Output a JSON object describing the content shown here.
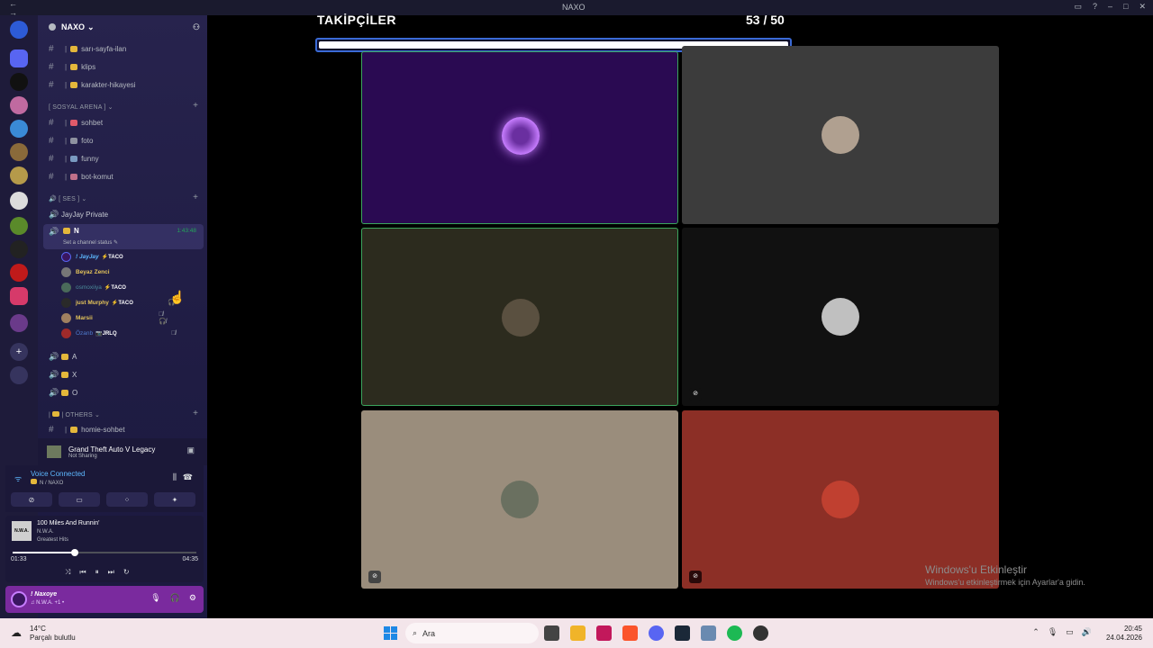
{
  "window": {
    "title": "NAXO"
  },
  "server": {
    "name": "NAXO"
  },
  "top_channels": [
    {
      "name": "sarı-sayfa-ilan"
    },
    {
      "name": "klips"
    },
    {
      "name": "karakter-hikayesi"
    }
  ],
  "categories": {
    "social": "[ SOSYAL ARENA ]",
    "voice": "[ SES ]",
    "others": "OTHERS"
  },
  "social_channels": [
    {
      "name": "sohbet"
    },
    {
      "name": "foto"
    },
    {
      "name": "funny"
    },
    {
      "name": "bot-komut"
    }
  ],
  "voice_channels": {
    "private": "JayJay Private",
    "active": {
      "name": "N",
      "timer": "1:43:48",
      "status": "Set a channel status"
    },
    "others": [
      "A",
      "X",
      "O"
    ]
  },
  "voice_users": [
    {
      "name": "! JayJay",
      "tag": "TACO",
      "color": "#5db8ff"
    },
    {
      "name": "Beyaz Zenci",
      "tag": "",
      "color": "#e4c45a"
    },
    {
      "name": "osmoxiiya",
      "tag": "TACO",
      "color": "#4a8a9a"
    },
    {
      "name": "just Murphy",
      "tag": "TACO",
      "color": "#e4c45a"
    },
    {
      "name": "Marsii",
      "tag": "",
      "color": "#e4c45a"
    },
    {
      "name": "Özanb",
      "tag": "JRLQ",
      "color": "#4f7ccf"
    }
  ],
  "others_channels": [
    {
      "name": "homie-sohbet"
    }
  ],
  "activity": {
    "game": "Grand Theft Auto V Legacy",
    "sub": "Not Sharing"
  },
  "voice_connected": {
    "title": "Voice Connected",
    "sub": "N / NAXO"
  },
  "music": {
    "album_art_text": "N.W.A.",
    "track": "100 Miles And Runnin'",
    "artist": "N.W.A.",
    "album": "Greatest Hits",
    "elapsed": "01:33",
    "duration": "04:35",
    "progress": 0.34
  },
  "user": {
    "name": "! Naxoye",
    "status": "♫ N.W.A. +1 •"
  },
  "stream": {
    "title": "TAKİPÇİLER",
    "count": "53 / 50",
    "progress": 1.0
  },
  "tiles": [
    {
      "bg": "#2a0a52",
      "border": "#3ba55d"
    },
    {
      "bg": "#3c3c3c",
      "border": "none"
    },
    {
      "bg": "#2c2b1e",
      "border": "#3ba55d"
    },
    {
      "bg": "#111111",
      "border": "none"
    },
    {
      "bg": "#9a8d7c",
      "border": "none"
    },
    {
      "bg": "#8c2f26",
      "border": "none"
    }
  ],
  "watermark": {
    "line1": "Windows'u Etkinleştir",
    "line2": "Windows'u etkinleştirmek için Ayarlar'a gidin."
  },
  "taskbar": {
    "temp": "14°C",
    "weather": "Parçalı bulutlu",
    "search_placeholder": "Ara",
    "time": "20:45",
    "date": "24.04.2026"
  }
}
